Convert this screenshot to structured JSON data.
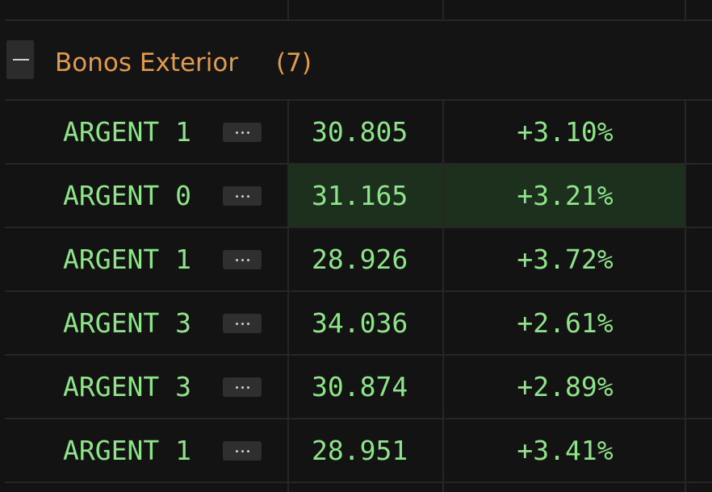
{
  "group": {
    "title": "Bonos Exterior",
    "count": "(7)"
  },
  "rows": [
    {
      "name": "ARGENT 1",
      "price": "30.805",
      "change": "+3.10%",
      "highlighted": false
    },
    {
      "name": "ARGENT 0",
      "price": "31.165",
      "change": "+3.21%",
      "highlighted": true
    },
    {
      "name": "ARGENT 1",
      "price": "28.926",
      "change": "+3.72%",
      "highlighted": false
    },
    {
      "name": "ARGENT 3",
      "price": "34.036",
      "change": "+2.61%",
      "highlighted": false
    },
    {
      "name": "ARGENT 3",
      "price": "30.874",
      "change": "+2.89%",
      "highlighted": false
    },
    {
      "name": "ARGENT 1",
      "price": "28.951",
      "change": "+3.41%",
      "highlighted": false
    }
  ],
  "colors": {
    "background": "#131313",
    "group_title": "#e19a4e",
    "positive_text": "#8fe38a",
    "row_highlight": "#1c301d",
    "grid_line": "#262626"
  },
  "icons": {
    "collapse": "minus-icon",
    "row_menu": "ellipsis-icon"
  }
}
